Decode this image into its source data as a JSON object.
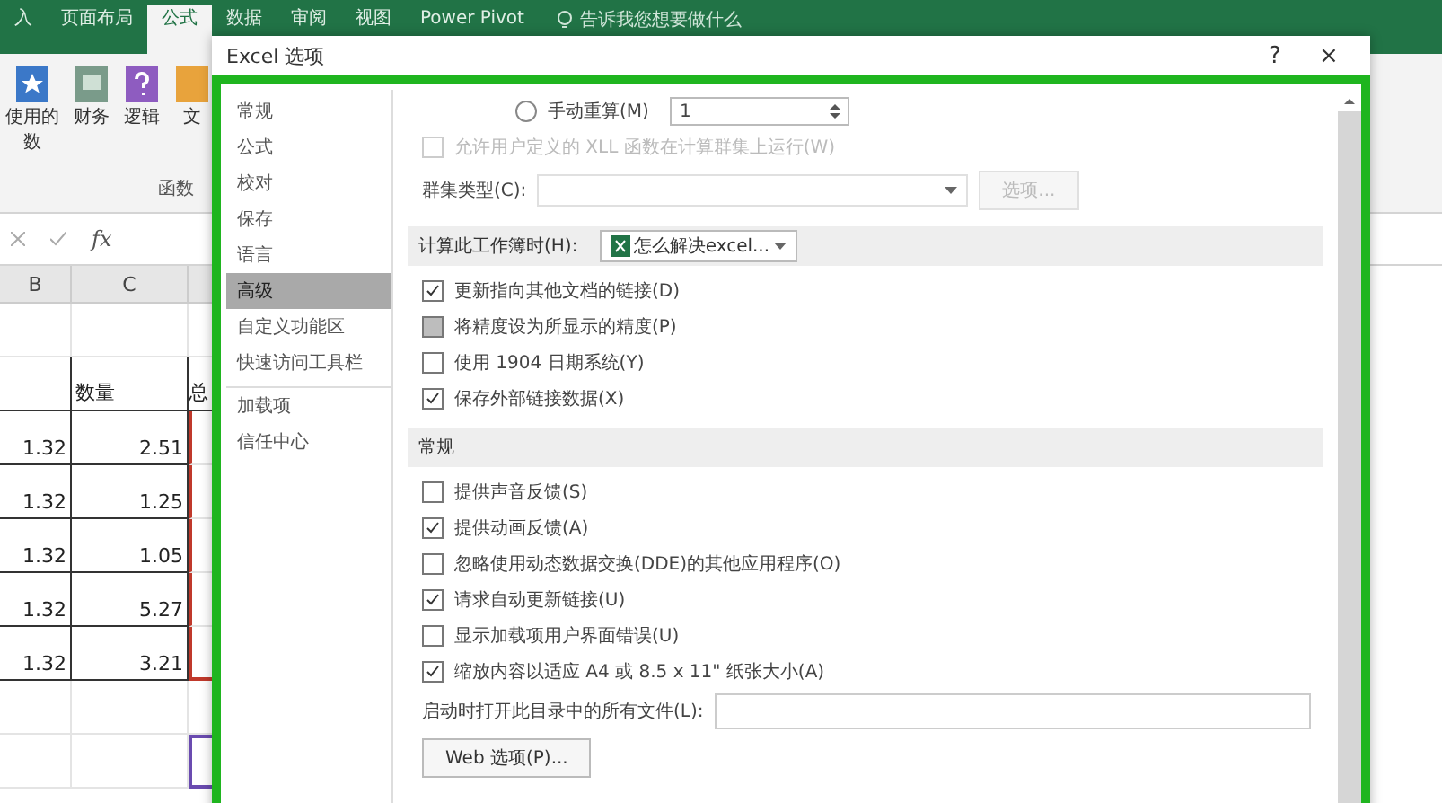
{
  "ribbon_tabs": [
    {
      "label": "入",
      "selected": false
    },
    {
      "label": "页面布局",
      "selected": false
    },
    {
      "label": "公式",
      "selected": true
    },
    {
      "label": "数据",
      "selected": false
    },
    {
      "label": "审阅",
      "selected": false
    },
    {
      "label": "视图",
      "selected": false
    },
    {
      "label": "Power Pivot",
      "selected": false
    }
  ],
  "tell_me": {
    "placeholder": "告诉我您想要做什么"
  },
  "ribbon_commands": [
    {
      "kind": "star",
      "lines": [
        "使用的",
        "数"
      ]
    },
    {
      "kind": "book",
      "lines": [
        "财务"
      ]
    },
    {
      "kind": "question",
      "lines": [
        "逻辑"
      ]
    },
    {
      "kind": "text",
      "lines": [
        "文"
      ]
    }
  ],
  "ribbon_group_label": "函数",
  "formula_bar": {
    "function_label": "fx"
  },
  "sheet": {
    "columns": [
      "B",
      "C"
    ],
    "header": {
      "column_c": "数量",
      "column_d": "总"
    },
    "rows": [
      {
        "b": "1.32",
        "c": "2.51"
      },
      {
        "b": "1.32",
        "c": "1.25"
      },
      {
        "b": "1.32",
        "c": "1.05"
      },
      {
        "b": "1.32",
        "c": "5.27"
      },
      {
        "b": "1.32",
        "c": "3.21"
      }
    ]
  },
  "dialog": {
    "title": "Excel 选项",
    "help": "?",
    "close": "×",
    "nav": [
      {
        "label": "常规",
        "selected": false,
        "divider_before": false
      },
      {
        "label": "公式",
        "selected": false,
        "divider_before": false
      },
      {
        "label": "校对",
        "selected": false,
        "divider_before": false
      },
      {
        "label": "保存",
        "selected": false,
        "divider_before": false
      },
      {
        "label": "语言",
        "selected": false,
        "divider_before": false
      },
      {
        "label": "高级",
        "selected": true,
        "divider_before": false
      },
      {
        "label": "自定义功能区",
        "selected": false,
        "divider_before": false
      },
      {
        "label": "快速访问工具栏",
        "selected": false,
        "divider_before": false
      },
      {
        "label": "加载项",
        "selected": false,
        "divider_before": true
      },
      {
        "label": "信任中心",
        "selected": false,
        "divider_before": false
      }
    ],
    "content": [
      {
        "kind": "radio",
        "label": "手动重算(M)",
        "checked": false,
        "value": "1"
      },
      {
        "kind": "checkbox",
        "label": "允许用户定义的 XLL 函数在计算群集上运行(W)",
        "checked": false,
        "disabled": true,
        "hovered": false
      },
      {
        "kind": "select",
        "label": "群集类型(C):",
        "button": "选项...",
        "disabled": true
      },
      {
        "kind": "section",
        "label": "计算此工作簿时(H):",
        "select_value": "怎么解决excel..."
      },
      {
        "kind": "checkbox",
        "label": "更新指向其他文档的链接(D)",
        "checked": true,
        "disabled": false,
        "hovered": false
      },
      {
        "kind": "checkbox",
        "label": "将精度设为所显示的精度(P)",
        "checked": false,
        "disabled": false,
        "hovered": true
      },
      {
        "kind": "checkbox",
        "label": "使用 1904 日期系统(Y)",
        "checked": false,
        "disabled": false,
        "hovered": false
      },
      {
        "kind": "checkbox",
        "label": "保存外部链接数据(X)",
        "checked": true,
        "disabled": false,
        "hovered": false
      },
      {
        "kind": "section",
        "label": "常规"
      },
      {
        "kind": "checkbox",
        "label": "提供声音反馈(S)",
        "checked": false,
        "disabled": false,
        "hovered": false
      },
      {
        "kind": "checkbox",
        "label": "提供动画反馈(A)",
        "checked": true,
        "disabled": false,
        "hovered": false
      },
      {
        "kind": "checkbox",
        "label": "忽略使用动态数据交换(DDE)的其他应用程序(O)",
        "checked": false,
        "disabled": false,
        "hovered": false
      },
      {
        "kind": "checkbox",
        "label": "请求自动更新链接(U)",
        "checked": true,
        "disabled": false,
        "hovered": false
      },
      {
        "kind": "checkbox",
        "label": "显示加载项用户界面错误(U)",
        "checked": false,
        "disabled": false,
        "hovered": false
      },
      {
        "kind": "checkbox",
        "label": "缩放内容以适应 A4 或 8.5 x 11\" 纸张大小(A)",
        "checked": true,
        "disabled": false,
        "hovered": false
      },
      {
        "kind": "field",
        "label": "启动时打开此目录中的所有文件(L):"
      },
      {
        "kind": "button",
        "label": "Web 选项(P)..."
      }
    ]
  }
}
